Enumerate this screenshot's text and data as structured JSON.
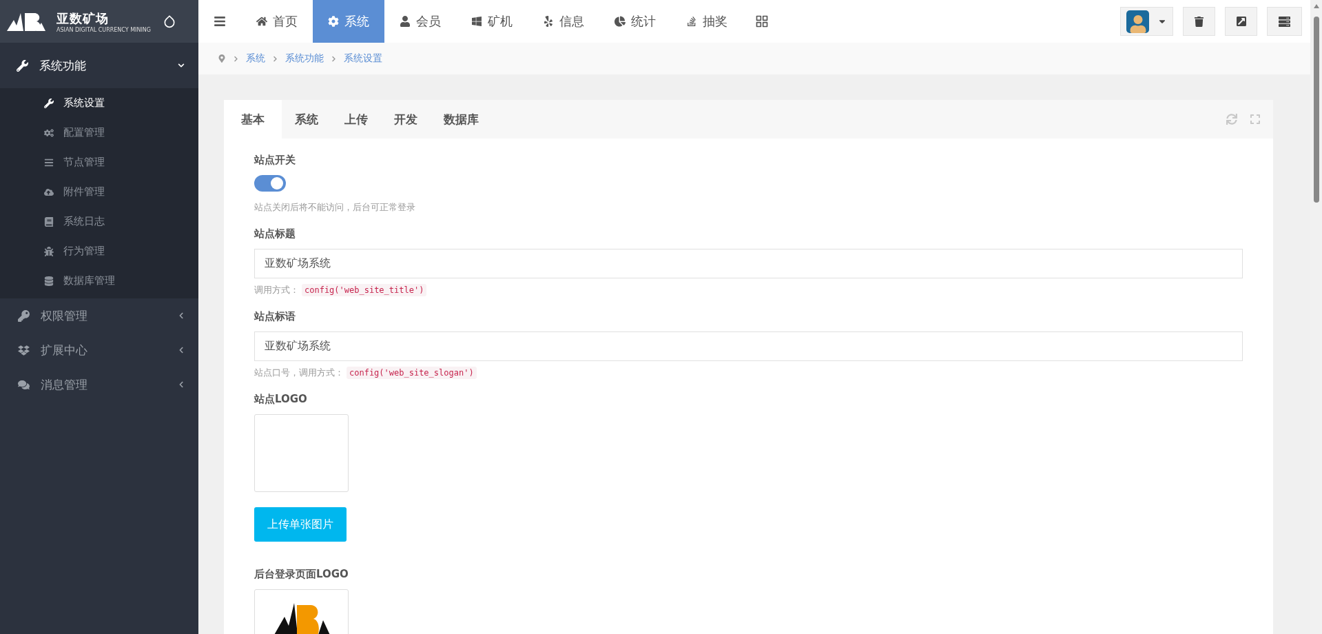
{
  "brand": {
    "name": "亚数矿场",
    "tagline": "ASIAN DIGITAL CURRENCY MINING"
  },
  "top_nav": [
    {
      "label": "首页",
      "selected": false
    },
    {
      "label": "系统",
      "selected": true
    },
    {
      "label": "会员",
      "selected": false
    },
    {
      "label": "矿机",
      "selected": false
    },
    {
      "label": "信息",
      "selected": false
    },
    {
      "label": "统计",
      "selected": false
    },
    {
      "label": "抽奖",
      "selected": false
    }
  ],
  "breadcrumb": [
    "系统",
    "系统功能",
    "系统设置"
  ],
  "sidebar": {
    "items": [
      {
        "label": "系统功能",
        "expanded": true,
        "children": [
          {
            "label": "系统设置",
            "selected": true
          },
          {
            "label": "配置管理",
            "selected": false
          },
          {
            "label": "节点管理",
            "selected": false
          },
          {
            "label": "附件管理",
            "selected": false
          },
          {
            "label": "系统日志",
            "selected": false
          },
          {
            "label": "行为管理",
            "selected": false
          },
          {
            "label": "数据库管理",
            "selected": false
          }
        ]
      },
      {
        "label": "权限管理",
        "expanded": false
      },
      {
        "label": "扩展中心",
        "expanded": false
      },
      {
        "label": "消息管理",
        "expanded": false
      }
    ]
  },
  "tabs": [
    {
      "label": "基本",
      "selected": true
    },
    {
      "label": "系统",
      "selected": false
    },
    {
      "label": "上传",
      "selected": false
    },
    {
      "label": "开发",
      "selected": false
    },
    {
      "label": "数据库",
      "selected": false
    }
  ],
  "form": {
    "fields": [
      {
        "kind": "switch",
        "label": "站点开关",
        "on": true,
        "help": "站点关闭后将不能访问，后台可正常登录"
      },
      {
        "kind": "text",
        "label": "站点标题",
        "value": "亚数矿场系统",
        "help": "调用方式：",
        "code": "config('web_site_title')"
      },
      {
        "kind": "text",
        "label": "站点标语",
        "value": "亚数矿场系统",
        "help": "站点口号，调用方式：",
        "code": "config('web_site_slogan')"
      },
      {
        "kind": "image",
        "label": "站点LOGO",
        "has_image": false,
        "button": "上传单张图片"
      },
      {
        "kind": "image",
        "label": "后台登录页面LOGO",
        "has_image": true
      }
    ]
  }
}
